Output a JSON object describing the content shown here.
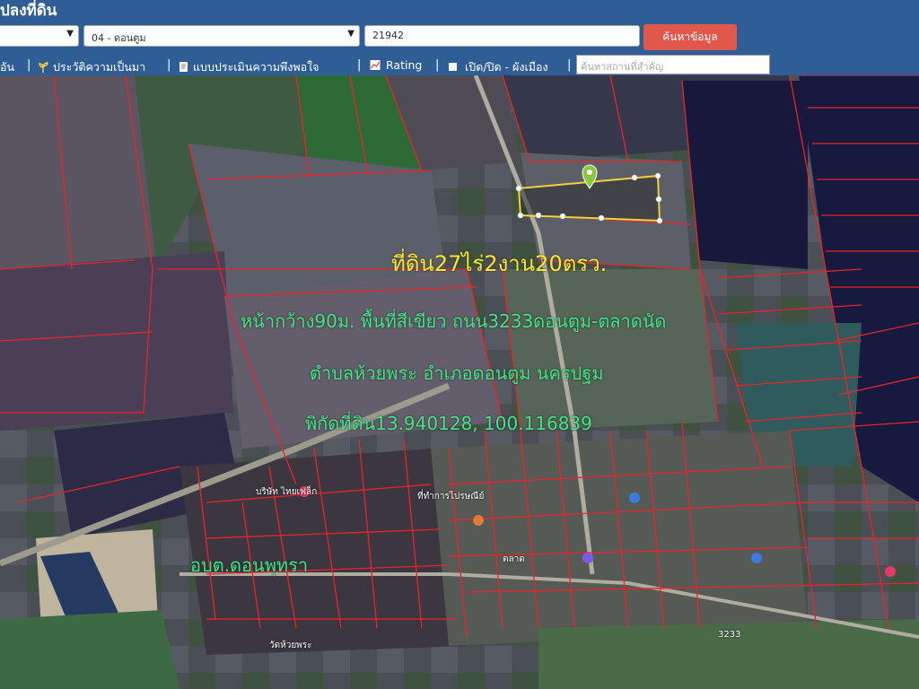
{
  "header": {
    "title": "ปลงที่ดิน",
    "province_select": "",
    "district_select": "04 - ดอนตูม",
    "parcel_input": "21942",
    "search_button": "ค้นหาข้อมูล"
  },
  "toolbar": {
    "item1": "อัน",
    "item2": "ประวัติความเป็นมา",
    "item3": "แบบประเมินความพึงพอใจ",
    "item4": "Rating",
    "item5": "เปิด/ปิด - ผังเมือง",
    "place_search_placeholder": "ค้นหาสถานที่สำคัญ",
    "separator": "|"
  },
  "overlay": {
    "line1": "ที่ดิน27ไร่2งาน20ตรว.",
    "line2": "หน้ากว้าง90ม. พื้นที่สีเขียว ถนน3233ดอนตูม-ตลาดนัด",
    "line3": "ตำบลห้วยพระ อำเภอดอนตูม นครปฐม",
    "line4": "พิกัดที่ดิน13.940128, 100.116839",
    "line5": "อบต.ดอนพุทรา"
  },
  "map_labels": {
    "poi1": "บริษัท ไทยเฟล็ก",
    "poi2": "ที่ทำการไปรษณีย์",
    "poi3": "วัดห้วยพระ",
    "poi4": "ตลาด",
    "road_code": "3233"
  },
  "colors": {
    "header_bg": "#2f5e97",
    "search_button": "#e2574c",
    "parcel_lines": "#e8242b",
    "highlight_parcel": "#f2d23a",
    "overlay_text": "#4ce08a",
    "overlay_title": "#f7e63b"
  },
  "icons": {
    "pin": "map-pin-icon",
    "poi": "poi-marker-icon"
  }
}
